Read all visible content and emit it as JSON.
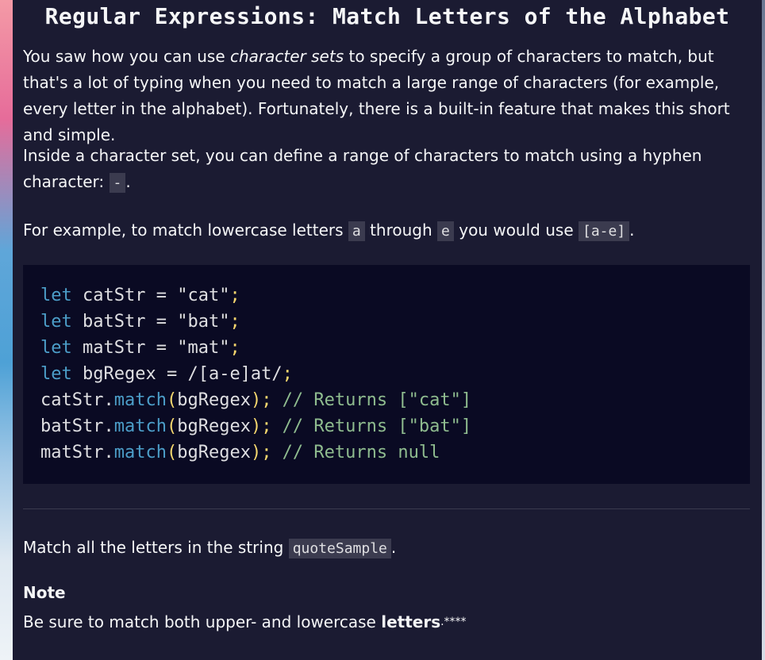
{
  "lesson": {
    "title": "Regular Expressions: Match Letters of the Alphabet",
    "p1_start": "You saw how you can use ",
    "p1_em": "character sets",
    "p1_end": " to specify a group of characters to match, but that's a lot of typing when you need to match a large range of characters (for example, every letter in the alphabet). Fortunately, there is a built-in feature that makes this short and simple.",
    "p2_text": "Inside a character set, you can define a range of characters to match using a hyphen character: ",
    "p2_code": "-",
    "p2_end": ".",
    "p3_a": "For example, to match lowercase letters ",
    "p3_code1": "a",
    "p3_b": " through ",
    "p3_code2": "e",
    "p3_c": " you would use ",
    "p3_code3": "[a-e]",
    "p3_d": "."
  },
  "code_lines": [
    [
      {
        "t": "let",
        "c": "kw"
      },
      {
        "t": " catStr ",
        "c": "plain"
      },
      {
        "t": "=",
        "c": "op"
      },
      {
        "t": " ",
        "c": "plain"
      },
      {
        "t": "\"cat\"",
        "c": "str"
      },
      {
        "t": ";",
        "c": "punc"
      }
    ],
    [
      {
        "t": "let",
        "c": "kw"
      },
      {
        "t": " batStr ",
        "c": "plain"
      },
      {
        "t": "=",
        "c": "op"
      },
      {
        "t": " ",
        "c": "plain"
      },
      {
        "t": "\"bat\"",
        "c": "str"
      },
      {
        "t": ";",
        "c": "punc"
      }
    ],
    [
      {
        "t": "let",
        "c": "kw"
      },
      {
        "t": " matStr ",
        "c": "plain"
      },
      {
        "t": "=",
        "c": "op"
      },
      {
        "t": " ",
        "c": "plain"
      },
      {
        "t": "\"mat\"",
        "c": "str"
      },
      {
        "t": ";",
        "c": "punc"
      }
    ],
    [
      {
        "t": "let",
        "c": "kw"
      },
      {
        "t": " bgRegex ",
        "c": "plain"
      },
      {
        "t": "=",
        "c": "op"
      },
      {
        "t": " /[a-e]at/",
        "c": "str"
      },
      {
        "t": ";",
        "c": "punc"
      }
    ],
    [
      {
        "t": "catStr",
        "c": "plain"
      },
      {
        "t": ".",
        "c": "plain"
      },
      {
        "t": "match",
        "c": "fn"
      },
      {
        "t": "(",
        "c": "punc"
      },
      {
        "t": "bgRegex",
        "c": "plain"
      },
      {
        "t": ")",
        "c": "punc"
      },
      {
        "t": ";",
        "c": "punc"
      },
      {
        "t": " // Returns [\"cat\"]",
        "c": "cmt"
      }
    ],
    [
      {
        "t": "batStr",
        "c": "plain"
      },
      {
        "t": ".",
        "c": "plain"
      },
      {
        "t": "match",
        "c": "fn"
      },
      {
        "t": "(",
        "c": "punc"
      },
      {
        "t": "bgRegex",
        "c": "plain"
      },
      {
        "t": ")",
        "c": "punc"
      },
      {
        "t": ";",
        "c": "punc"
      },
      {
        "t": " // Returns [\"bat\"]",
        "c": "cmt"
      }
    ],
    [
      {
        "t": "matStr",
        "c": "plain"
      },
      {
        "t": ".",
        "c": "plain"
      },
      {
        "t": "match",
        "c": "fn"
      },
      {
        "t": "(",
        "c": "punc"
      },
      {
        "t": "bgRegex",
        "c": "plain"
      },
      {
        "t": ")",
        "c": "punc"
      },
      {
        "t": ";",
        "c": "punc"
      },
      {
        "t": " // Returns null",
        "c": "cmt"
      }
    ]
  ],
  "instructions": {
    "text": "Match all the letters in the string ",
    "code": "quoteSample",
    "end": "."
  },
  "note": {
    "title": "Note",
    "text": "Be sure to match both upper- and lowercase ",
    "bold": "letters",
    "end": ".****"
  },
  "colors": {
    "panel_bg": "#1b1b32",
    "code_bg": "#0a0a23",
    "inline_code_bg": "#3b3b4f",
    "keyword": "#4c9ec9",
    "comment": "#8fbc8f",
    "punctuation": "#f5d76e"
  }
}
